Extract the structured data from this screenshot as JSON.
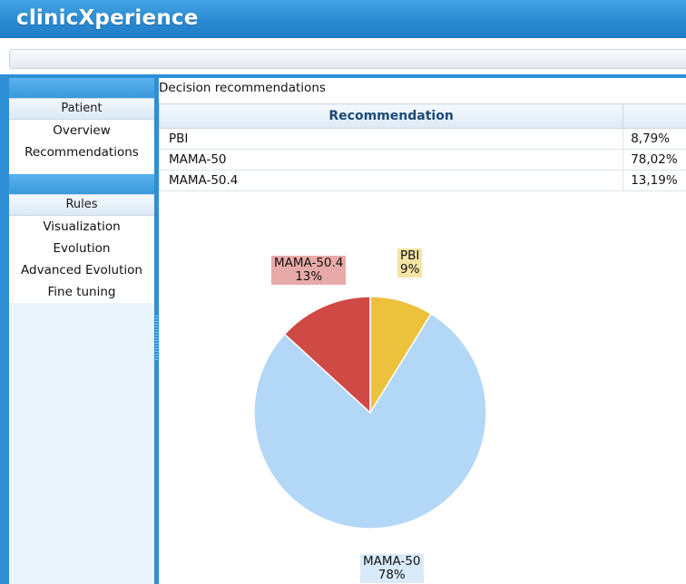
{
  "app": {
    "title": "clinicXperience"
  },
  "sidebar": {
    "groups": [
      {
        "label": "Patient",
        "items": [
          "Overview",
          "Recommendations"
        ]
      },
      {
        "label": "Rules",
        "items": [
          "Visualization",
          "Evolution",
          "Advanced Evolution",
          "Fine tuning"
        ]
      }
    ]
  },
  "panel": {
    "title": "Decision recommendations"
  },
  "table": {
    "header": "Recommendation",
    "rows": [
      {
        "name": "PBI",
        "value": "8,79%"
      },
      {
        "name": "MAMA-50",
        "value": "78,02%"
      },
      {
        "name": "MAMA-50.4",
        "value": "13,19%"
      }
    ]
  },
  "chart_data": {
    "type": "pie",
    "slices": [
      {
        "label": "PBI",
        "value": 8.79,
        "display": "9%",
        "color": "#ecc23c",
        "label_bg": "#f6e4a6"
      },
      {
        "label": "MAMA-50",
        "value": 78.02,
        "display": "78%",
        "color": "#b3d7f6",
        "label_bg": "#d9eaf9"
      },
      {
        "label": "MAMA-50.4",
        "value": 13.19,
        "display": "13%",
        "color": "#cf4a45",
        "label_bg": "#e8aaa8"
      }
    ],
    "start": "top",
    "direction": "clockwise"
  },
  "colors": {
    "header_blue": "#2b8bd2",
    "frame_blue": "#2e8fd6",
    "table_header_text": "#1a4a78"
  }
}
